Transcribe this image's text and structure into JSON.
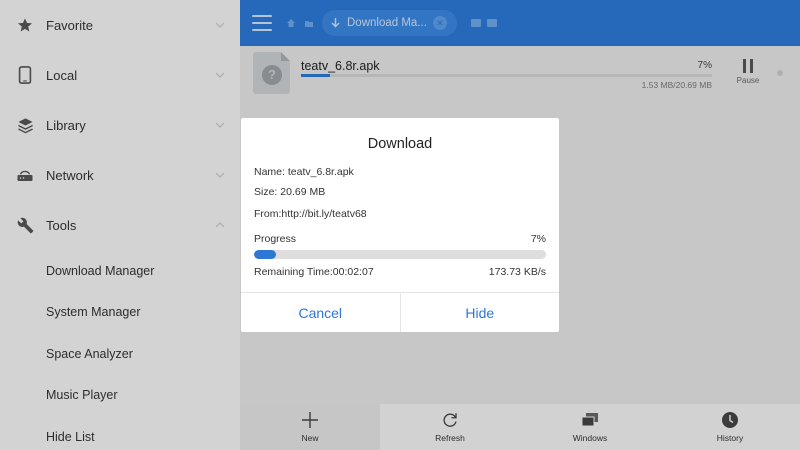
{
  "sidebar": {
    "items": [
      {
        "label": "Favorite",
        "icon": "star-icon"
      },
      {
        "label": "Local",
        "icon": "phone-icon"
      },
      {
        "label": "Library",
        "icon": "layers-icon"
      },
      {
        "label": "Network",
        "icon": "router-icon"
      },
      {
        "label": "Tools",
        "icon": "wrench-icon"
      }
    ],
    "tools_subitems": [
      "Download Manager",
      "System Manager",
      "Space Analyzer",
      "Music Player",
      "Hide List"
    ]
  },
  "header": {
    "breadcrumb_label": "Download Ma...",
    "accent_color": "#2c78d4"
  },
  "download": {
    "file_name": "teatv_6.8r.apk",
    "percent_text": "7%",
    "progress": 0.07,
    "size_text": "1.53 MB/20.69 MB",
    "pause_label": "Pause"
  },
  "dialog": {
    "title": "Download",
    "name_line": "Name: teatv_6.8r.apk",
    "size_line": "Size: 20.69 MB",
    "from_line": "From:http://bit.ly/teatv68",
    "progress_label": "Progress",
    "progress_percent": "7%",
    "remaining": "Remaining Time:00:02:07",
    "speed": "173.73 KB/s",
    "cancel_label": "Cancel",
    "hide_label": "Hide"
  },
  "bottombar": {
    "items": [
      {
        "label": "New",
        "icon": "plus-icon"
      },
      {
        "label": "Refresh",
        "icon": "refresh-icon"
      },
      {
        "label": "Windows",
        "icon": "windows-icon"
      },
      {
        "label": "History",
        "icon": "clock-icon"
      }
    ]
  }
}
